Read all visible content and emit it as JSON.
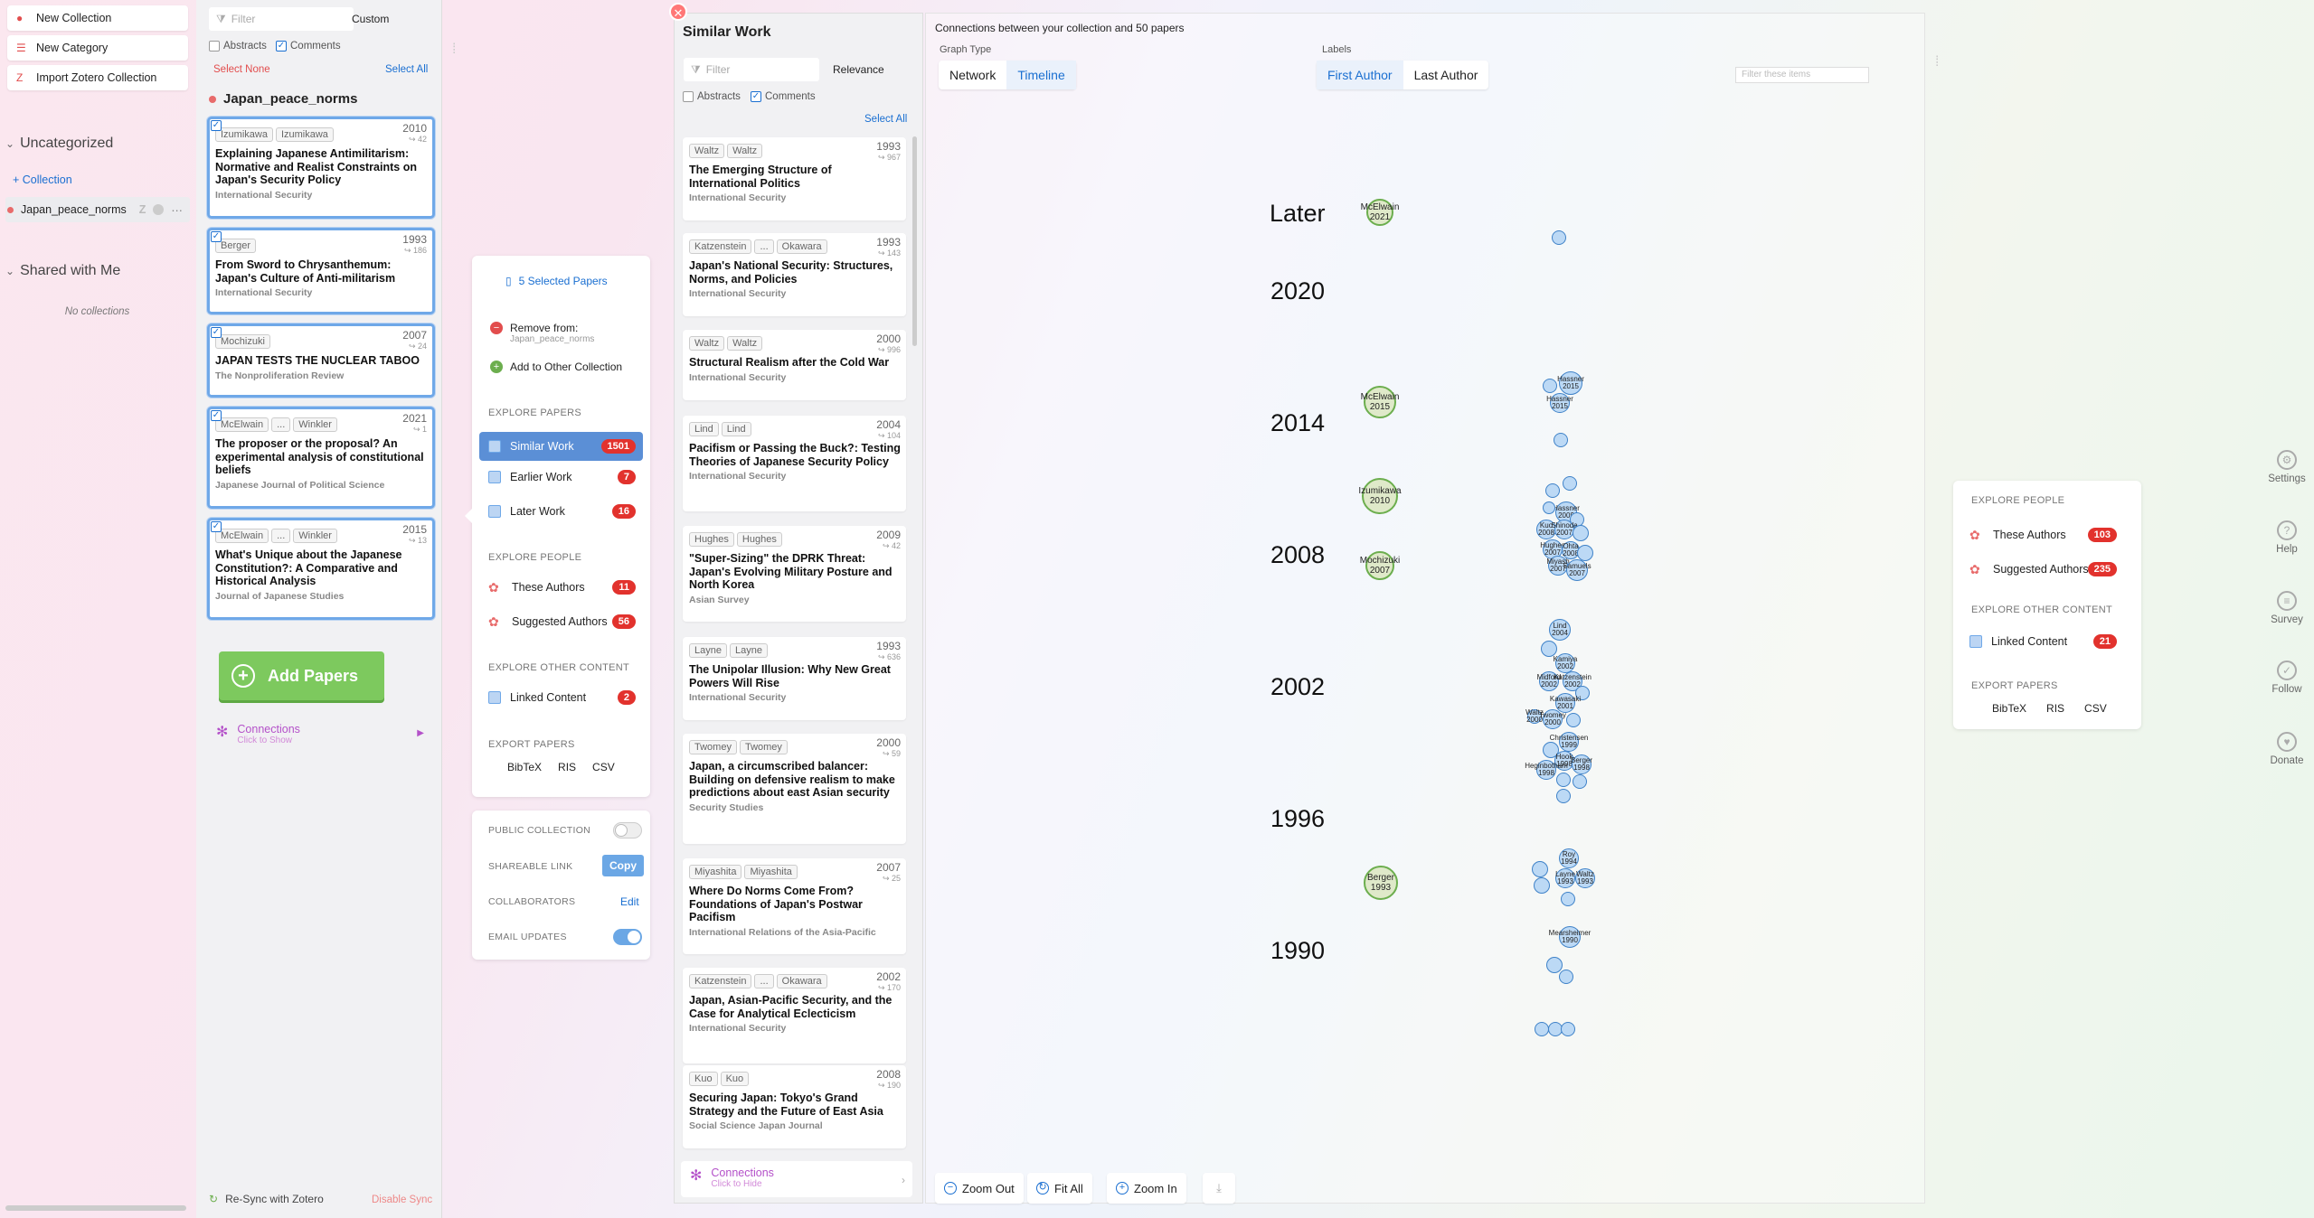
{
  "sidebar": {
    "buttons": [
      "New Collection",
      "New Category",
      "Import Zotero Collection"
    ],
    "uncategorized": "Uncategorized",
    "add_collection": "+ Collection",
    "collection_name": "Japan_peace_norms",
    "collection_badges": "Z",
    "shared_head": "Shared with Me",
    "no_collections": "No collections",
    "resync": "Re-Sync with Zotero",
    "disable_sync": "Disable Sync"
  },
  "papers": {
    "filter_placeholder": "Filter",
    "custom": "Custom",
    "abstracts": "Abstracts",
    "comments": "Comments",
    "select_none": "Select None",
    "select_all": "Select All",
    "title": "Japan_peace_norms",
    "items": [
      {
        "a1": "Izumikawa",
        "a2": "Izumikawa",
        "ellipsis": "",
        "year": "2010",
        "cites": "↪ 42",
        "title": "Explaining Japanese Antimilitarism: Normative and Realist Constraints on Japan's Security Policy",
        "journal": "International Security"
      },
      {
        "a1": "Berger",
        "a2": "",
        "ellipsis": "",
        "year": "1993",
        "cites": "↪ 186",
        "title": "From Sword to Chrysanthemum: Japan's Culture of Anti-militarism",
        "journal": "International Security"
      },
      {
        "a1": "Mochizuki",
        "a2": "",
        "ellipsis": "",
        "year": "2007",
        "cites": "↪ 24",
        "title": "JAPAN TESTS THE NUCLEAR TABOO",
        "journal": "The Nonproliferation Review"
      },
      {
        "a1": "McElwain",
        "a2": "Winkler",
        "ellipsis": "...",
        "year": "2021",
        "cites": "↪ 1",
        "title": "The proposer or the proposal? An experimental analysis of constitutional beliefs",
        "journal": "Japanese Journal of Political Science"
      },
      {
        "a1": "McElwain",
        "a2": "Winkler",
        "ellipsis": "...",
        "year": "2015",
        "cites": "↪ 13",
        "title": "What's Unique about the Japanese Constitution?: A Comparative and Historical Analysis",
        "journal": "Journal of Japanese Studies"
      }
    ],
    "add_papers": "Add Papers",
    "connections": "Connections",
    "connections_sub": "Click to Show"
  },
  "actions": {
    "selected": "5 Selected Papers",
    "remove_from": "Remove from:",
    "remove_collection": "Japan_peace_norms",
    "add_other": "Add to Other Collection",
    "explore_papers": "EXPLORE PAPERS",
    "similar": "Similar Work",
    "similar_n": "1501",
    "earlier": "Earlier Work",
    "earlier_n": "7",
    "later": "Later Work",
    "later_n": "16",
    "explore_people": "EXPLORE PEOPLE",
    "these_authors": "These Authors",
    "these_n": "11",
    "suggested": "Suggested Authors",
    "suggested_n": "56",
    "explore_other": "EXPLORE OTHER CONTENT",
    "linked": "Linked Content",
    "linked_n": "2",
    "export": "EXPORT PAPERS",
    "bibtex": "BibTeX",
    "ris": "RIS",
    "csv": "CSV",
    "public": "PUBLIC COLLECTION",
    "shareable": "SHAREABLE LINK",
    "copy": "Copy",
    "collaborators": "COLLABORATORS",
    "edit": "Edit",
    "email": "EMAIL UPDATES"
  },
  "similar": {
    "title": "Similar Work",
    "filter_placeholder": "Filter",
    "relevance": "Relevance",
    "abstracts": "Abstracts",
    "comments": "Comments",
    "select_all": "Select All",
    "items": [
      {
        "a1": "Waltz",
        "a2": "Waltz",
        "ellipsis": "",
        "year": "1993",
        "cites": "↪ 967",
        "title": "The Emerging Structure of International Politics",
        "journal": "International Security"
      },
      {
        "a1": "Katzenstein",
        "a2": "Okawara",
        "ellipsis": "...",
        "year": "1993",
        "cites": "↪ 143",
        "title": "Japan's National Security: Structures, Norms, and Policies",
        "journal": "International Security"
      },
      {
        "a1": "Waltz",
        "a2": "Waltz",
        "ellipsis": "",
        "year": "2000",
        "cites": "↪ 996",
        "title": "Structural Realism after the Cold War",
        "journal": "International Security"
      },
      {
        "a1": "Lind",
        "a2": "Lind",
        "ellipsis": "",
        "year": "2004",
        "cites": "↪ 104",
        "title": "Pacifism or Passing the Buck?: Testing Theories of Japanese Security Policy",
        "journal": "International Security"
      },
      {
        "a1": "Hughes",
        "a2": "Hughes",
        "ellipsis": "",
        "year": "2009",
        "cites": "↪ 42",
        "title": "\"Super-Sizing\" the DPRK Threat: Japan's Evolving Military Posture and North Korea",
        "journal": "Asian Survey"
      },
      {
        "a1": "Layne",
        "a2": "Layne",
        "ellipsis": "",
        "year": "1993",
        "cites": "↪ 636",
        "title": "The Unipolar Illusion: Why New Great Powers Will Rise",
        "journal": "International Security"
      },
      {
        "a1": "Twomey",
        "a2": "Twomey",
        "ellipsis": "",
        "year": "2000",
        "cites": "↪ 59",
        "title": "Japan, a circumscribed balancer: Building on defensive realism to make predictions about east Asian security",
        "journal": "Security Studies"
      },
      {
        "a1": "Miyashita",
        "a2": "Miyashita",
        "ellipsis": "",
        "year": "2007",
        "cites": "↪ 25",
        "title": "Where Do Norms Come From? Foundations of Japan's Postwar Pacifism",
        "journal": "International Relations of the Asia-Pacific"
      },
      {
        "a1": "Katzenstein",
        "a2": "Okawara",
        "ellipsis": "...",
        "year": "2002",
        "cites": "↪ 170",
        "title": "Japan, Asian-Pacific Security, and the Case for Analytical Eclecticism",
        "journal": "International Security"
      },
      {
        "a1": "Kuo",
        "a2": "Kuo",
        "ellipsis": "",
        "year": "2008",
        "cites": "↪ 190",
        "title": "Securing Japan: Tokyo's Grand Strategy and the Future of East Asia",
        "journal": "Social Science Japan Journal"
      }
    ],
    "connections": "Connections",
    "connections_sub": "Click to Hide"
  },
  "graph": {
    "heading": "Connections between your collection and 50 papers",
    "graph_type": "Graph Type",
    "network": "Network",
    "timeline": "Timeline",
    "labels": "Labels",
    "first_author": "First Author",
    "last_author": "Last Author",
    "filter_placeholder": "Filter these items",
    "years": [
      "Later",
      "2020",
      "2014",
      "2008",
      "2002",
      "1996",
      "1990"
    ],
    "green_nodes": [
      {
        "name": "McElwain",
        "year": "2021"
      },
      {
        "name": "McElwain",
        "year": "2015"
      },
      {
        "name": "Izumikawa",
        "year": "2010"
      },
      {
        "name": "Mochizuki",
        "year": "2007"
      },
      {
        "name": "Berger",
        "year": "1993"
      }
    ],
    "blue_labels": [
      "Hassner 2015",
      "Hassner 2015",
      "Hassner 2009",
      "Kuo 2008",
      "Shinoda 2007",
      "Hughes 2007",
      "Ohta 2008",
      "Miyash 2007",
      "Samuels 2007",
      "Lind 2004",
      "Kamiya 2002",
      "Midford 2002",
      "Katzenstein 2002",
      "Kawasaki 2001",
      "Waltz 2000",
      "Twomey 2000",
      "Christensen 1999",
      "Hook 1998",
      "Berger 1998",
      "Heginbotham 1998",
      "Roy 1994",
      "Layne 1993",
      "Waltz 1993",
      "Mearsheimer 1990"
    ],
    "zoom_out": "Zoom Out",
    "fit_all": "Fit All",
    "zoom_in": "Zoom In"
  },
  "right_panel": {
    "explore_people": "EXPLORE PEOPLE",
    "these_authors": "These Authors",
    "these_n": "103",
    "suggested": "Suggested Authors",
    "suggested_n": "235",
    "explore_other": "EXPLORE OTHER CONTENT",
    "linked": "Linked Content",
    "linked_n": "21",
    "export": "EXPORT PAPERS",
    "bibtex": "BibTeX",
    "ris": "RIS",
    "csv": "CSV"
  },
  "nav": [
    "Settings",
    "Help",
    "Survey",
    "Follow",
    "Donate"
  ],
  "colors": {
    "accent": "#1a6fd1",
    "badge": "#e2322d",
    "add_button": "#7dc95e",
    "selected_border": "#6fa8e8"
  }
}
